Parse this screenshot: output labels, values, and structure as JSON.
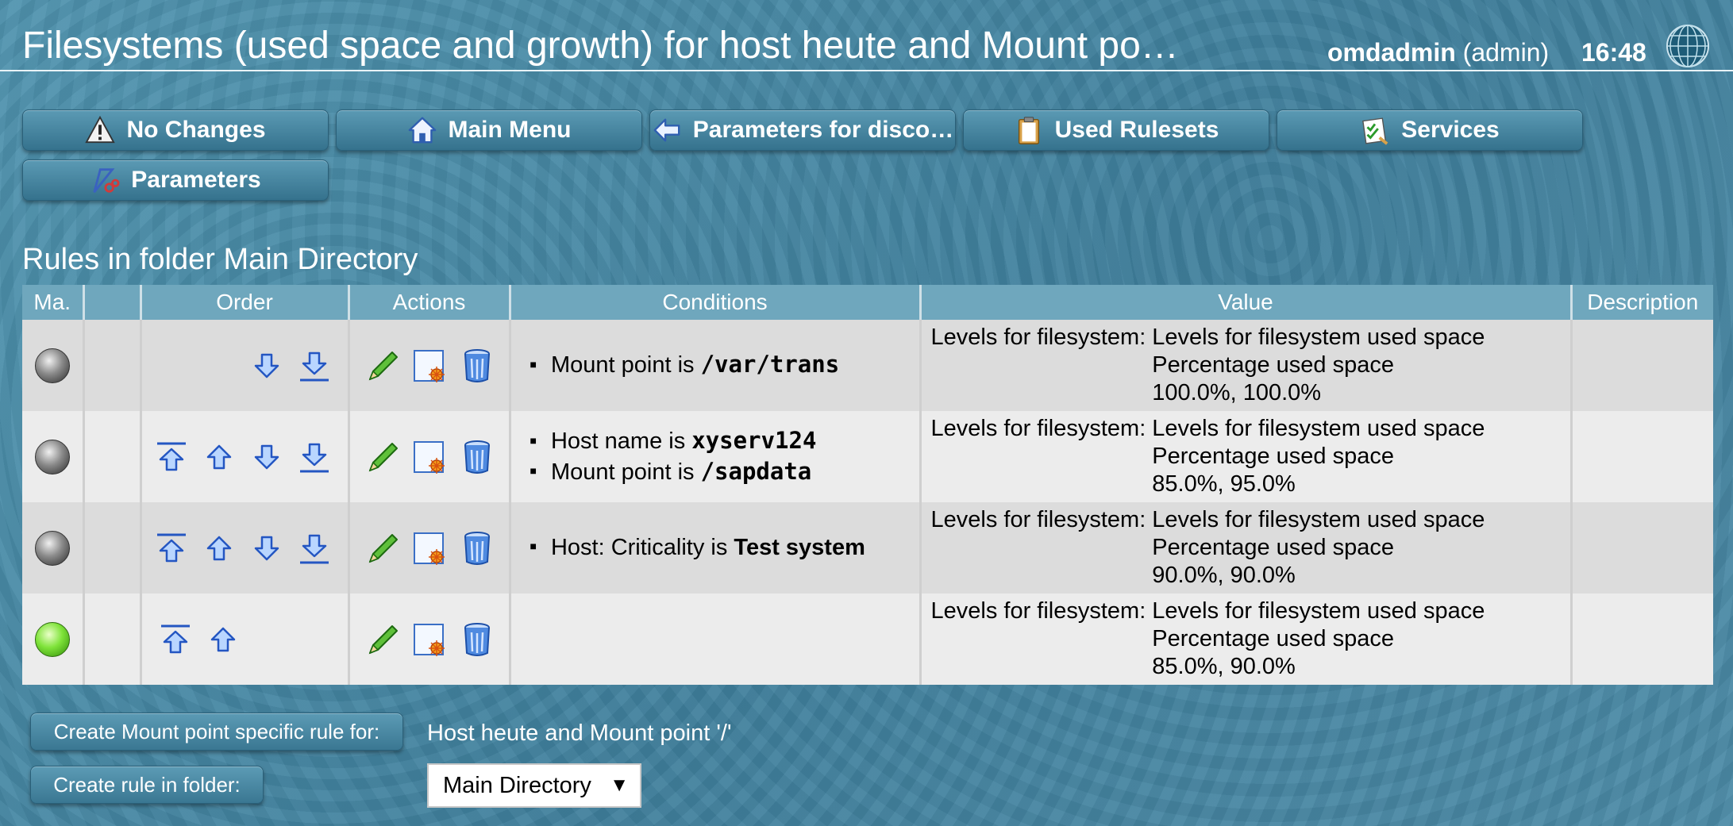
{
  "header": {
    "title": "Filesystems (used space and growth) for host heute and Mount po…",
    "user_name": "omdadmin",
    "user_role": "(admin)",
    "time": "16:48"
  },
  "buttons": {
    "no_changes": "No Changes",
    "main_menu": "Main Menu",
    "parameters_for_discovery": "Parameters for disco…",
    "used_rulesets": "Used Rulesets",
    "services": "Services",
    "parameters": "Parameters"
  },
  "section_title": "Rules in folder Main Directory",
  "table": {
    "headers": [
      "Ma.",
      "",
      "Order",
      "Actions",
      "Conditions",
      "Value",
      "Description"
    ],
    "value_label": "Levels for filesystem:",
    "rows": [
      {
        "status": "gray",
        "conditions": [
          {
            "text": "Mount point is ",
            "value": "/var/trans",
            "mono": true
          }
        ],
        "value_lines": [
          "Levels for filesystem used space",
          "Percentage used space",
          "100.0%, 100.0%"
        ],
        "description": ""
      },
      {
        "status": "gray",
        "conditions": [
          {
            "text": "Host name is ",
            "value": "xyserv124",
            "mono": true
          },
          {
            "text": "Mount point is ",
            "value": "/sapdata",
            "mono": true
          }
        ],
        "value_lines": [
          "Levels for filesystem used space",
          "Percentage used space",
          "85.0%, 95.0%"
        ],
        "description": ""
      },
      {
        "status": "gray",
        "conditions": [
          {
            "text": "Host: Criticality is ",
            "value": "Test system",
            "mono": false
          }
        ],
        "value_lines": [
          "Levels for filesystem used space",
          "Percentage used space",
          "90.0%, 90.0%"
        ],
        "description": ""
      },
      {
        "status": "green",
        "conditions": [],
        "value_lines": [
          "Levels for filesystem used space",
          "Percentage used space",
          "85.0%, 90.0%"
        ],
        "description": ""
      }
    ]
  },
  "footer": {
    "create_specific_label": "Create Mount point specific rule for:",
    "host_info": "Host heute and Mount point '/'",
    "create_in_folder_label": "Create rule in folder:",
    "folder_selected": "Main Directory"
  },
  "colors": {
    "background": "#4a8aa6",
    "header_row": "#6fa7bd",
    "row_odd": "#dcdcdc",
    "row_even": "#ececec"
  }
}
